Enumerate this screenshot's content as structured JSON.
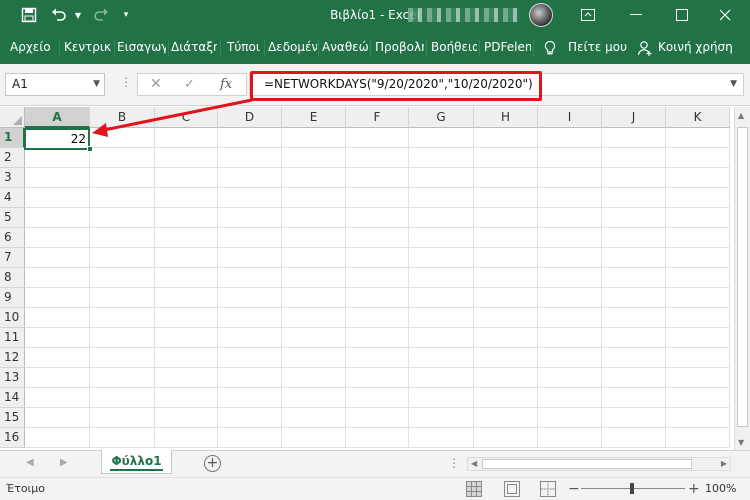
{
  "window": {
    "title": "Βιβλίο1  -  Excel",
    "icons": [
      "save-icon",
      "undo-icon",
      "redo-icon",
      "customize-qat-icon",
      "ribbon-display-icon",
      "minimize-icon",
      "maximize-icon",
      "close-icon"
    ]
  },
  "ribbon": {
    "tabs": [
      "Αρχείο",
      "Κεντρική",
      "Εισαγωγή",
      "Διάταξη",
      "Τύποι",
      "Δεδομένα",
      "Αναθεώρηση",
      "Προβολή",
      "Βοήθεια",
      "PDFelement"
    ],
    "tell_me": "Πείτε μου",
    "share": "Κοινή χρήση"
  },
  "formula_bar": {
    "name_box": "A1",
    "formula": "=NETWORKDAYS(\"9/20/2020\",\"10/20/2020\")",
    "fx_label": "fx",
    "highlight_color": "#e0141a"
  },
  "grid": {
    "columns": [
      "A",
      "B",
      "C",
      "D",
      "E",
      "F",
      "G",
      "H",
      "I",
      "J",
      "K"
    ],
    "rows": [
      "1",
      "2",
      "3",
      "4",
      "5",
      "6",
      "7",
      "8",
      "9",
      "10",
      "11",
      "12",
      "13",
      "14",
      "15",
      "16"
    ],
    "active_cell": {
      "ref": "A1",
      "value": "22"
    }
  },
  "sheets": {
    "tabs": [
      "Φύλλο1"
    ],
    "add_label": "+"
  },
  "status": {
    "ready": "Έτοιμο",
    "zoom": "100%"
  },
  "colors": {
    "accent": "#217346",
    "annotation": "#e0141a"
  }
}
